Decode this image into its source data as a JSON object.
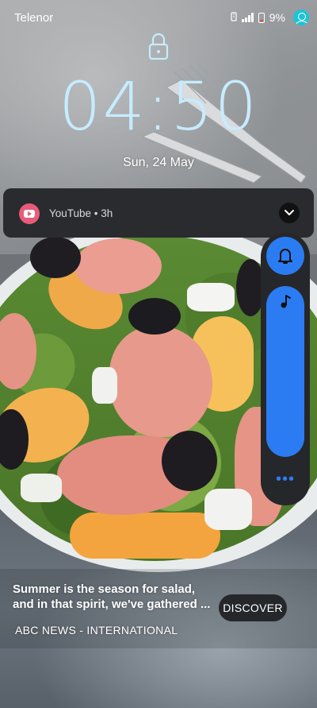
{
  "status_bar": {
    "carrier": "Telenor",
    "battery_percent": "9%",
    "signal_bars": 4,
    "icons": [
      "data-saver-icon",
      "signal-icon",
      "battery-low-icon",
      "account-icon"
    ]
  },
  "lock_screen": {
    "lock_icon": "lock-icon",
    "time": "04:50",
    "date": "Sun, 24 May"
  },
  "notification": {
    "app_icon": "youtube-icon",
    "meta": "YouTube • 3h",
    "expand_icon": "chevron-down-icon"
  },
  "volume_panel": {
    "ringer_icon": "bell-icon",
    "slider_icon": "music-note-icon",
    "slider_level": 1.0,
    "more_icon": "more-horizontal-icon",
    "more_label": "•••",
    "accent_color": "#2b7cf2"
  },
  "news_card": {
    "headline": "Summer is the season for salad, and in that spirit, we've gathered ...",
    "source": "ABC NEWS - INTERNATIONAL",
    "button_label": "DISCOVER"
  }
}
